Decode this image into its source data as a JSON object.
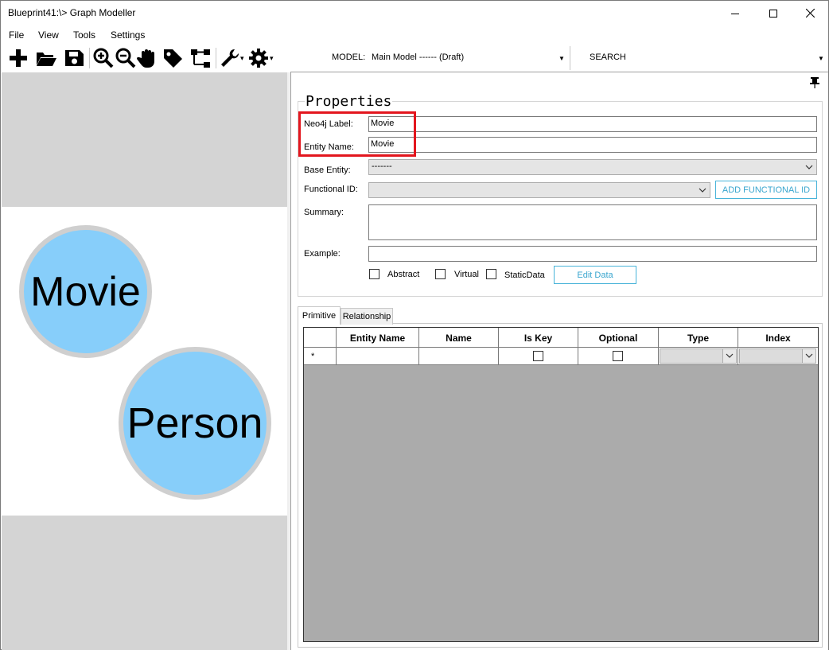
{
  "window": {
    "title": "Blueprint41:\\> Graph Modeller"
  },
  "menu": {
    "items": [
      "File",
      "View",
      "Tools",
      "Settings"
    ]
  },
  "toolbar": {
    "model_label": "MODEL:",
    "model_value": "Main Model ------ (Draft)",
    "search_label": "SEARCH"
  },
  "canvas": {
    "nodes": [
      {
        "label": "Movie",
        "color": "#87cefa"
      },
      {
        "label": "Person",
        "color": "#87cefa"
      }
    ]
  },
  "properties": {
    "title": "Properties",
    "neo4j_label": {
      "label": "Neo4j Label:",
      "value": "Movie"
    },
    "entity_name": {
      "label": "Entity Name:",
      "value": "Movie"
    },
    "base_entity": {
      "label": "Base Entity:",
      "value": "-------"
    },
    "functional_id": {
      "label": "Functional ID:",
      "value": ""
    },
    "add_functional_id": "ADD FUNCTIONAL ID",
    "summary": {
      "label": "Summary:",
      "value": ""
    },
    "example": {
      "label": "Example:",
      "value": ""
    },
    "checkboxes": [
      {
        "label": "Abstract",
        "checked": false
      },
      {
        "label": "Virtual",
        "checked": false
      },
      {
        "label": "StaticData",
        "checked": false
      }
    ],
    "edit_data": "Edit Data",
    "highlight_color": "#e3161e",
    "accent_color": "#48b4d9"
  },
  "tabs": [
    {
      "label": "Primitive",
      "active": true
    },
    {
      "label": "Relationship",
      "active": false
    }
  ],
  "grid": {
    "columns": [
      "",
      "Entity Name",
      "Name",
      "Is Key",
      "Optional",
      "Type",
      "Index"
    ],
    "new_row_marker": "*"
  }
}
